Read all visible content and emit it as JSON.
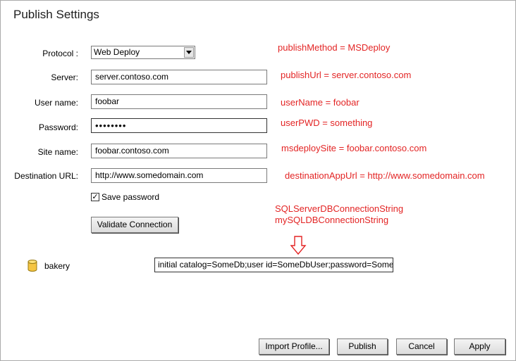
{
  "window": {
    "title": "Publish Settings"
  },
  "form": {
    "protocol_label": "Protocol :",
    "protocol_value": "Web Deploy",
    "server_label": "Server:",
    "server_value": "server.contoso.com",
    "username_label": "User name:",
    "username_value": "foobar",
    "password_label": "Password:",
    "password_mask": "••••••••",
    "sitename_label": "Site name:",
    "sitename_value": "foobar.contoso.com",
    "desturl_label": "Destination URL:",
    "desturl_value": "http://www.somedomain.com",
    "save_password_label": "Save password",
    "save_password_checked": true,
    "validate_button": "Validate Connection"
  },
  "annotations": {
    "protocol": "publishMethod = MSDeploy",
    "server": "publishUrl = server.contoso.com",
    "username": "userName = foobar",
    "password": "userPWD = something",
    "sitename": "msdeploySite = foobar.contoso.com",
    "desturl": "destinationAppUrl = http://www.somedomain.com",
    "conn_line1": "SQLServerDBConnectionString",
    "conn_line2": "mySQLDBConnectionString",
    "color": "#e32424"
  },
  "database": {
    "name": "bakery",
    "icon": "database-icon",
    "connection_string": "initial catalog=SomeDb;user id=SomeDbUser;password=SomePasswo"
  },
  "footer": {
    "import_button": "Import Profile...",
    "publish_button": "Publish",
    "cancel_button": "Cancel",
    "apply_button": "Apply"
  }
}
